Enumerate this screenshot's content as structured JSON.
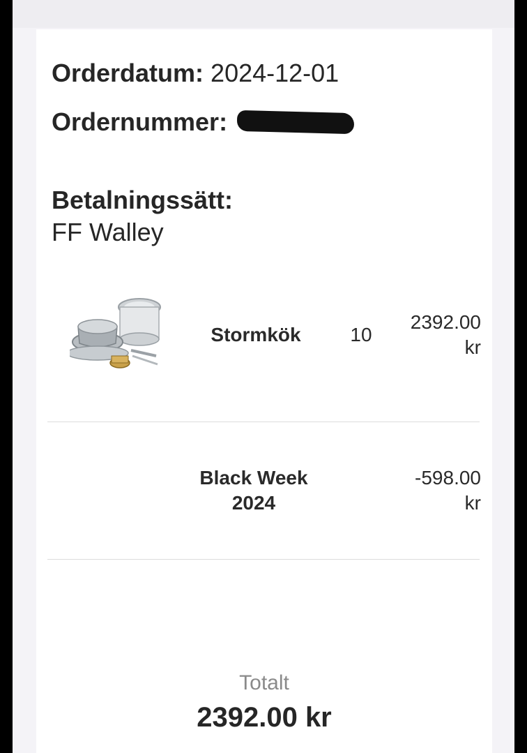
{
  "order": {
    "date_label": "Orderdatum:",
    "date_value": "2024-12-01",
    "number_label": "Ordernummer:"
  },
  "payment": {
    "label": "Betalningssätt:",
    "value": "FF Walley"
  },
  "items": [
    {
      "name": "Stormkök",
      "quantity": "10",
      "price_amount": "2392.00",
      "price_currency": "kr",
      "icon": "camping-stove-product-image"
    },
    {
      "name_line1": "Black Week",
      "name_line2": "2024",
      "price_amount": "-598.00",
      "price_currency": "kr"
    }
  ],
  "total": {
    "label": "Totalt",
    "value": "2392.00 kr"
  }
}
